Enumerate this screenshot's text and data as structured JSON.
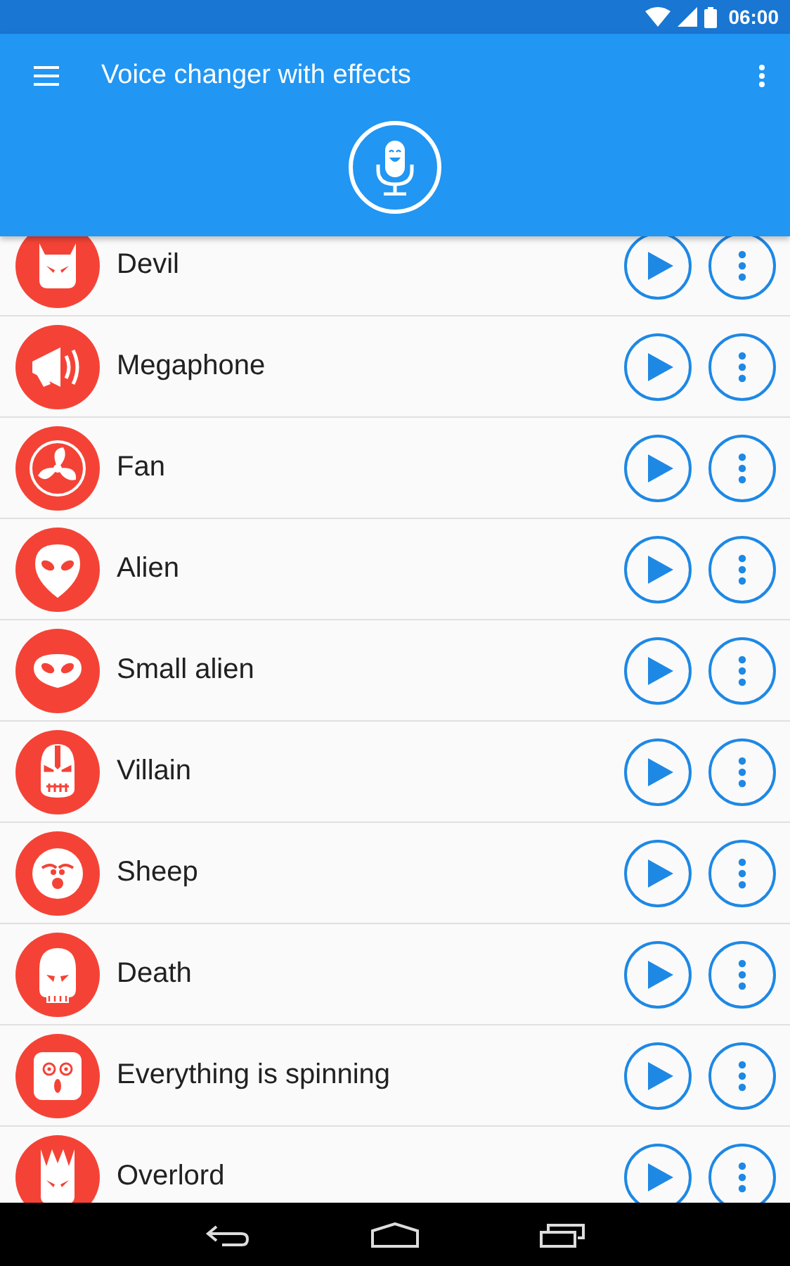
{
  "status_bar": {
    "time": "06:00"
  },
  "app_bar": {
    "title": "Voice changer with effects"
  },
  "effects": [
    {
      "name": "Devil"
    },
    {
      "name": "Megaphone"
    },
    {
      "name": "Fan"
    },
    {
      "name": "Alien"
    },
    {
      "name": "Small alien"
    },
    {
      "name": "Villain"
    },
    {
      "name": "Sheep"
    },
    {
      "name": "Death"
    },
    {
      "name": "Everything is spinning"
    },
    {
      "name": "Overlord"
    }
  ]
}
